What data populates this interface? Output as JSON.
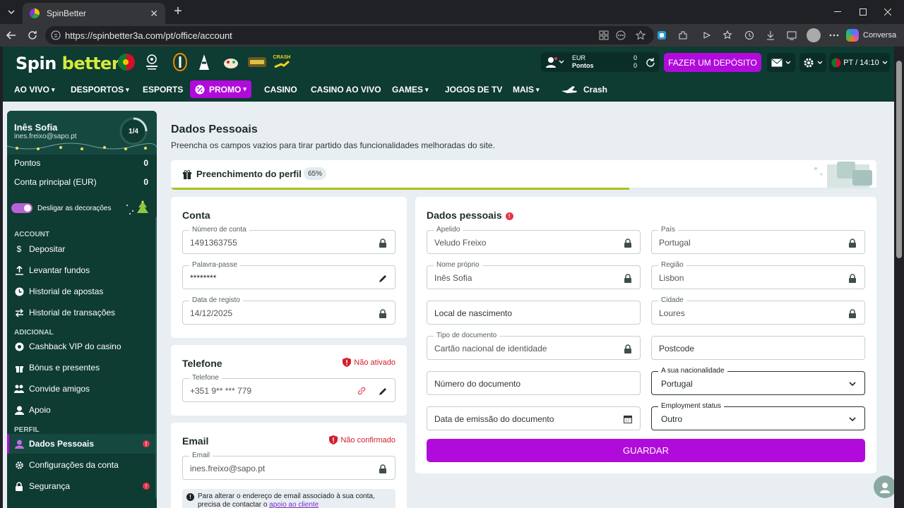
{
  "browser": {
    "tab_title": "SpinBetter",
    "url": "https://spinbetter3a.com/pt/office/account",
    "copilot_label": "Conversa"
  },
  "site": {
    "logo_part1": "Spin",
    "logo_part2": "better",
    "account": {
      "currency": "EUR",
      "currency_value": "0",
      "points_label": "Pontos",
      "points_value": "0"
    },
    "deposit_label": "FAZER UM DEPÓSITO",
    "lang_time": "PT / 14:10",
    "crash_badge": "CRASH"
  },
  "menu": [
    {
      "label": "AO VIVO",
      "chev": true
    },
    {
      "label": "DESPORTOS",
      "chev": true
    },
    {
      "label": "ESPORTS",
      "chev": false
    },
    {
      "label": "PROMO",
      "chev": true
    },
    {
      "label": "CASINO",
      "chev": false
    },
    {
      "label": "CASINO AO VIVO",
      "chev": false
    },
    {
      "label": "GAMES",
      "chev": true
    },
    {
      "label": "JOGOS DE TV",
      "chev": false
    },
    {
      "label": "MAIS",
      "chev": true
    },
    {
      "label": "Crash",
      "chev": false
    }
  ],
  "sidebar": {
    "user_name": "Inês Sofia",
    "user_email": "ines.freixo@sapo.pt",
    "progress_label": "1/4",
    "progress_fraction": 0.25,
    "points_label": "Pontos",
    "points_value": "0",
    "main_account_label": "Conta principal (EUR)",
    "main_account_value": "0",
    "decor_toggle_label": "Desligar as decorações",
    "sections": {
      "account": "ACCOUNT",
      "additional": "ADICIONAL",
      "profile": "PERFIL"
    },
    "items": [
      {
        "label": "Depositar"
      },
      {
        "label": "Levantar fundos"
      },
      {
        "label": "Historial de apostas"
      },
      {
        "label": "Historial de transações"
      },
      {
        "label": "Cashback VIP do casino"
      },
      {
        "label": "Bónus e presentes"
      },
      {
        "label": "Convide amigos"
      },
      {
        "label": "Apoio"
      },
      {
        "label": "Dados Pessoais"
      },
      {
        "label": "Configurações da conta"
      },
      {
        "label": "Segurança"
      }
    ]
  },
  "main": {
    "title": "Dados Pessoais",
    "subtitle": "Preencha os campos vazios para tirar partido das funcionalidades melhoradas do site.",
    "completion_title": "Preenchimento do perfil",
    "completion_pct": "65%",
    "completion_fraction": 0.65,
    "account_card": {
      "title": "Conta",
      "account_number_label": "Número de conta",
      "account_number": "1491363755",
      "password_label": "Palavra-passe",
      "password": "********",
      "reg_date_label": "Data de registo",
      "reg_date": "14/12/2025"
    },
    "phone_card": {
      "title": "Telefone",
      "status": "Não ativado",
      "phone_label": "Telefone",
      "phone": "+351 9** *** 779"
    },
    "email_card": {
      "title": "Email",
      "status": "Não confirmado",
      "email_label": "Email",
      "email": "ines.freixo@sapo.pt",
      "note_text": "Para alterar o endereço de email associado à sua conta, precisa de contactar o ",
      "note_link": "apoio ao cliente"
    },
    "personal": {
      "title": "Dados pessoais",
      "surname_label": "Apelido",
      "surname": "Veludo Freixo",
      "first_name_label": "Nome próprio",
      "first_name": "Inês Sofia",
      "birthplace_placeholder": "Local de nascimento",
      "doc_type_label": "Tipo de documento",
      "doc_type": "Cartão nacional de identidade",
      "doc_number_placeholder": "Número do documento",
      "doc_issue_placeholder": "Data de emissão do documento",
      "country_label": "País",
      "country": "Portugal",
      "region_label": "Região",
      "region": "Lisbon",
      "city_label": "Cidade",
      "city": "Loures",
      "postcode_placeholder": "Postcode",
      "nationality_label": "A sua nacionalidade",
      "nationality": "Portugal",
      "employment_label": "Employment status",
      "employment": "Outro",
      "save_label": "GUARDAR"
    }
  }
}
